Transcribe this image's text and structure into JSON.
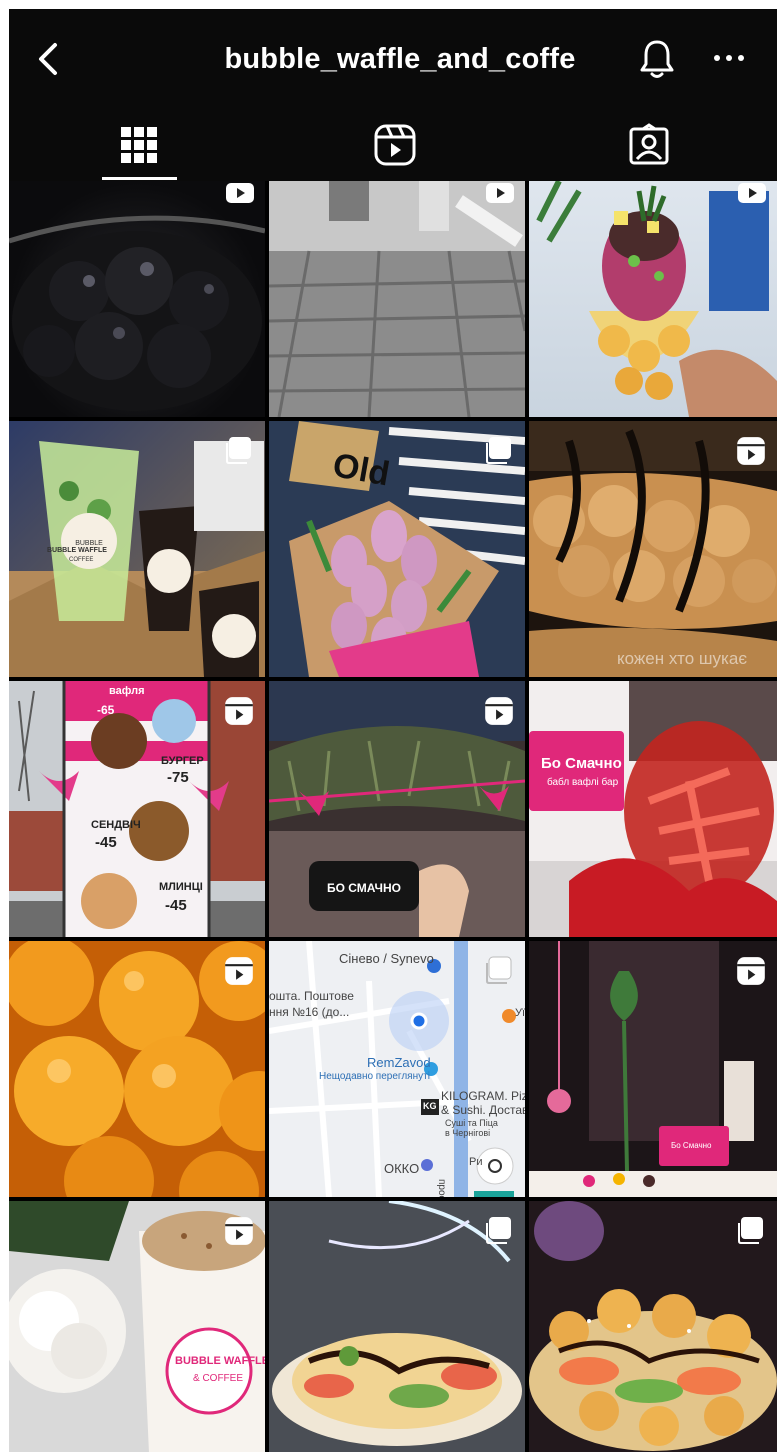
{
  "header": {
    "title": "bubble_waffle_and_coffe"
  },
  "tabs": [
    {
      "name": "grid",
      "icon": "grid-icon",
      "active": true
    },
    {
      "name": "reels",
      "icon": "reels-icon",
      "active": false
    },
    {
      "name": "tagged",
      "icon": "tagged-person-icon",
      "active": false
    }
  ],
  "posts": [
    {
      "kind": "reel",
      "subject": "black tapioca pearls"
    },
    {
      "kind": "reel",
      "subject": "paving stones"
    },
    {
      "kind": "reel",
      "subject": "bubble waffle cone"
    },
    {
      "kind": "carousel",
      "subject": "drinks to go"
    },
    {
      "kind": "carousel",
      "subject": "tulip bouquet"
    },
    {
      "kind": "reel",
      "subject": "waffle with chocolate"
    },
    {
      "kind": "reel",
      "subject": "street menu board"
    },
    {
      "kind": "reel",
      "subject": "cafe entrance garland"
    },
    {
      "kind": "carousel",
      "subject": "jar of sweets"
    },
    {
      "kind": "reel",
      "subject": "orange popping boba"
    },
    {
      "kind": "carousel",
      "subject": "map screenshot"
    },
    {
      "kind": "reel",
      "subject": "cafe interior"
    },
    {
      "kind": "reel",
      "subject": "coffee cup"
    },
    {
      "kind": "carousel",
      "subject": "crepe"
    },
    {
      "kind": "carousel",
      "subject": "waffle with salmon"
    }
  ],
  "overlays": {
    "waffle_caption": "кожен хто шукає",
    "phone_screen": "БО СМАЧНО",
    "cup_brand": "BUBBLE WAFFLE",
    "cup_sub": "COFFEE",
    "jar_sign_title": "Бо Смачно",
    "jar_sign_sub": "бабл вафлі бар",
    "interior_sign": "Бо Смачно",
    "coffee_brand": "BUBBLE WAFFLE",
    "coffee_sub": "& COFFEE"
  },
  "menu_board": {
    "top_label": "вафля",
    "top_price": "-65",
    "burger_label": "БУРГЕР",
    "burger_price": "-75",
    "sandwich_label": "СЕНДВІЧ",
    "sandwich_price": "-45",
    "pancake_label": "МЛИНЦІ",
    "pancake_price": "-45"
  },
  "map": {
    "city": "Сінево / Synevo",
    "post1": "ошта. Поштове",
    "post2": "ння №16 (до...",
    "remzavod": "RemZavod",
    "remzavod_sub": "Нещодавно переглянуті",
    "kilogram1": "KILOGRAM. Pizz",
    "kilogram2": "& Sushi. Достав",
    "kilogram3": "Суші та Піца",
    "kilogram4": "в Чернігові",
    "kg_badge": "KG",
    "okko": "ОККО",
    "street": "проспект",
    "right_edge": "Уї",
    "right_edge2": "Ри"
  },
  "colors": {
    "header_bg": "#0a0a0a",
    "accent_pink": "#e0287a",
    "map_bg": "#eef0f3"
  }
}
